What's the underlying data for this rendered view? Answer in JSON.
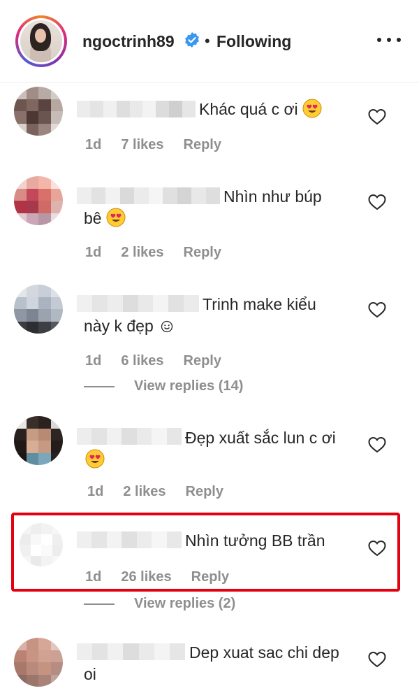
{
  "header": {
    "username": "ngoctrinh89",
    "separator": "•",
    "follow_status": "Following"
  },
  "comments": [
    {
      "text": "Khác quá c ơi",
      "emoji": "heart-eyes-emoji",
      "time": "1d",
      "likes": "7 likes",
      "reply": "Reply"
    },
    {
      "text_line1": "Nhìn như búp",
      "text_line2": "bê",
      "emoji": "heart-eyes-emoji",
      "time": "1d",
      "likes": "2 likes",
      "reply": "Reply"
    },
    {
      "text_line1": "Trinh make kiểu",
      "text_line2": "này k đẹp",
      "emoji": "smiley-emoji",
      "time": "1d",
      "likes": "6 likes",
      "reply": "Reply",
      "view_replies": "View replies (14)"
    },
    {
      "text_line1": "Đẹp xuất sắc lun c ơi",
      "emoji": "heart-eyes-emoji",
      "time": "1d",
      "likes": "2 likes",
      "reply": "Reply"
    },
    {
      "text": "Nhìn tưởng BB trần",
      "time": "1d",
      "likes": "26 likes",
      "reply": "Reply",
      "view_replies": "View replies (2)",
      "highlight_color": "#e3000f"
    },
    {
      "text_line1": "Dep xuat sac chi dep",
      "text_line2": "oi"
    }
  ],
  "colors": {
    "text": "#262626",
    "muted": "#8e8e8e",
    "verified_blue": "#3897f0",
    "highlight_red": "#e3000f"
  }
}
